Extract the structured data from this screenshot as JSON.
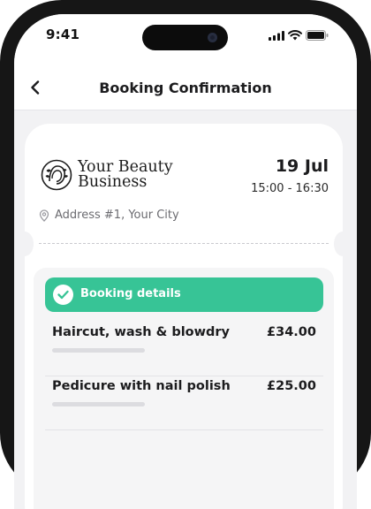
{
  "status_bar": {
    "time": "9:41"
  },
  "nav": {
    "title": "Booking Confirmation",
    "back_icon": "chevron-left-icon"
  },
  "booking": {
    "business_name_line1": "Your Beauty",
    "business_name_line2": "Business",
    "date": "19 Jul",
    "time_range": "15:00 - 16:30",
    "address": "Address #1, Your City"
  },
  "details": {
    "title": "Booking details",
    "services": [
      {
        "name": "Haircut, wash & blowdry",
        "price": "£34.00"
      },
      {
        "name": "Pedicure with nail polish",
        "price": "£25.00"
      }
    ]
  },
  "colors": {
    "accent_green": "#37c496",
    "phone_frame": "#161616",
    "screen_background": "#f2f2f4"
  }
}
